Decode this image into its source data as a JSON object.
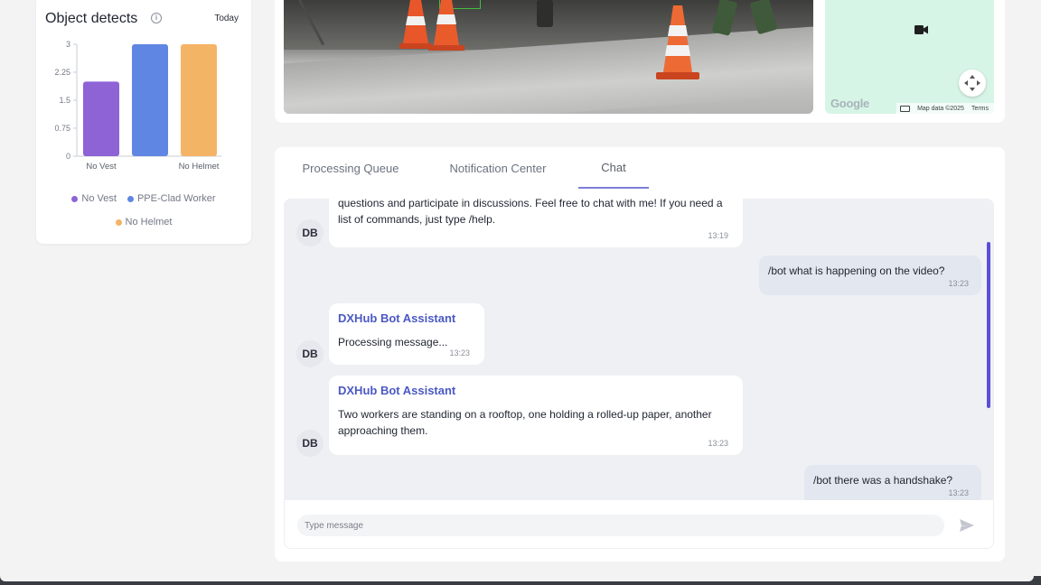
{
  "detect_card": {
    "title": "Object detects",
    "period": "Today"
  },
  "chart_data": {
    "type": "bar",
    "title": "",
    "xlabel": "",
    "ylabel": "",
    "ylim": [
      0,
      3
    ],
    "y_ticks": [
      "3",
      "2.25",
      "1.5",
      "0.75",
      "0"
    ],
    "categories": [
      "No Vest",
      "PPE-Clad Worker",
      "No Helmet"
    ],
    "x_tick_labels": [
      "No Vest",
      "",
      "No Helmet"
    ],
    "values": [
      2,
      3,
      3
    ],
    "colors": [
      "#8e63d6",
      "#5f86e3",
      "#f4b465"
    ],
    "legend": [
      "No Vest",
      "PPE-Clad Worker",
      "No Helmet"
    ],
    "legend_position": "bottom",
    "grid": false
  },
  "map": {
    "google_logo": "Google",
    "map_data": "Map data ©2025",
    "terms": "Terms",
    "camera_icon": "video-camera-icon",
    "control_icon": "pan-arrows-icon"
  },
  "tabs": [
    {
      "label": "Processing Queue",
      "active": false
    },
    {
      "label": "Notification Center",
      "active": false
    },
    {
      "label": "Chat",
      "active": true
    }
  ],
  "chat": {
    "messages": [
      {
        "from": "bot",
        "avatar": "DB",
        "sender": "",
        "text": "questions and participate in discussions. Feel free to chat with me! If you need a list of commands, just type /help.",
        "time": "13:19"
      },
      {
        "from": "user",
        "text": "/bot what is happening on the video?",
        "time": "13:23"
      },
      {
        "from": "bot",
        "avatar": "DB",
        "sender": "DXHub Bot Assistant",
        "text": "Processing message...",
        "time": "13:23"
      },
      {
        "from": "bot",
        "avatar": "DB",
        "sender": "DXHub Bot Assistant",
        "text": "Two workers are standing on a rooftop, one holding a rolled-up paper, another approaching them.",
        "time": "13:23"
      },
      {
        "from": "user",
        "text": "/bot there was a handshake?",
        "time": "13:23"
      }
    ],
    "input_placeholder": "Type message",
    "input_value": "",
    "send_icon": "send-icon"
  }
}
